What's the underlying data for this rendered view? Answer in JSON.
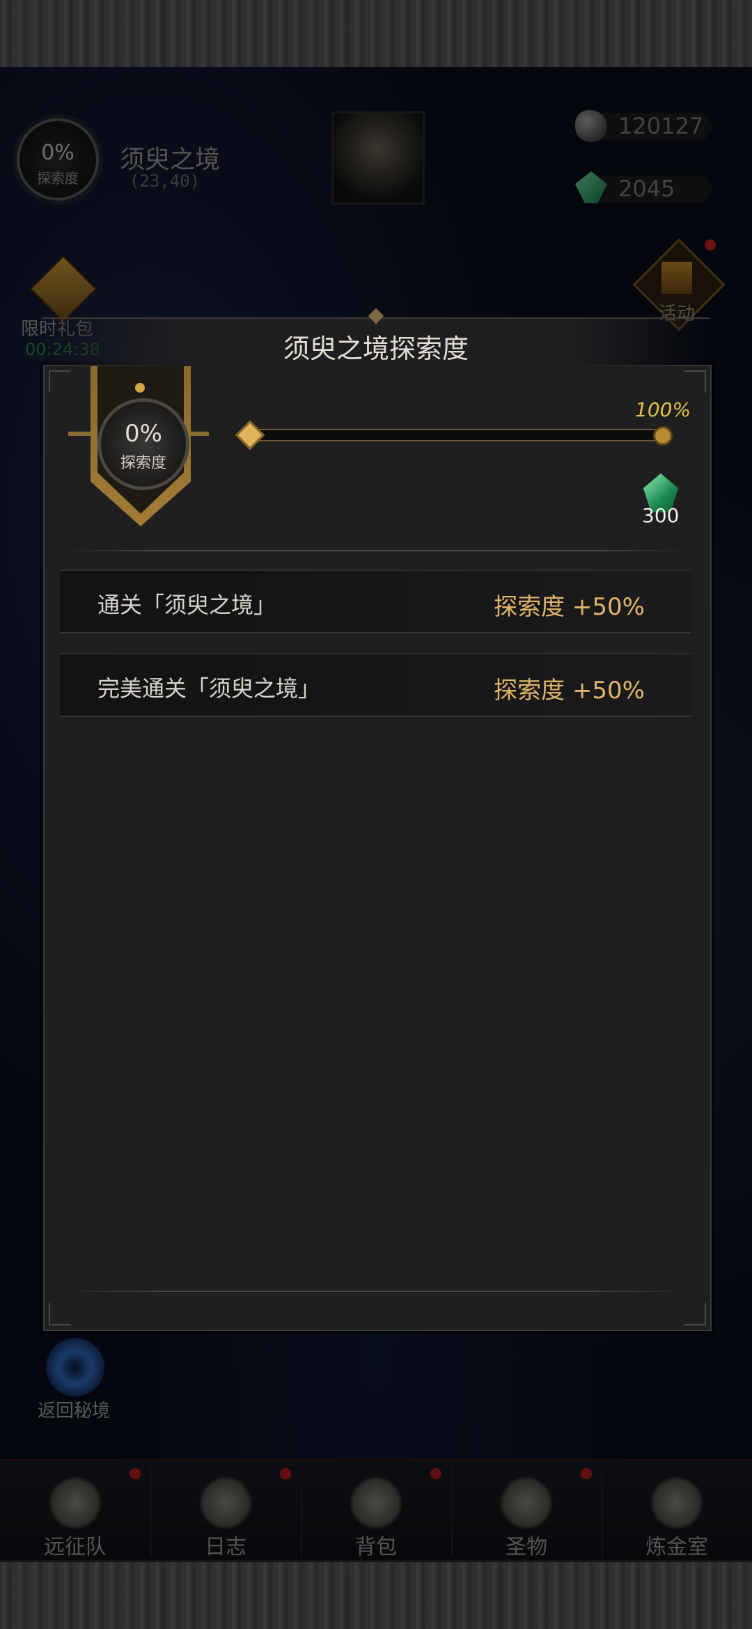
{
  "hud": {
    "zone_progress": "0%",
    "zone_progress_label": "探索度",
    "zone_name": "须臾之境",
    "zone_coords": "(23,40)",
    "resources": [
      {
        "icon": "ore-icon",
        "value": "120127"
      },
      {
        "icon": "green-gem-icon",
        "value": "2045"
      }
    ],
    "gift_pack": {
      "label": "限时礼包",
      "timer": "00:24:38"
    },
    "activity": {
      "label": "活动"
    }
  },
  "modal": {
    "title": "须臾之境探索度",
    "progress_value": "0%",
    "progress_label": "探索度",
    "progress_fraction": 0,
    "milestone_percent": "100%",
    "milestone_reward": {
      "icon": "green-gem-icon",
      "quantity": "300"
    },
    "tasks": [
      {
        "label": "通关「须臾之境」",
        "reward": "探索度 +50%"
      },
      {
        "label": "完美通关「须臾之境」",
        "reward": "探索度 +50%"
      }
    ]
  },
  "return_button": {
    "label": "返回秘境"
  },
  "nav": [
    {
      "label": "远征队",
      "icon": "helmet-icon",
      "badge": true
    },
    {
      "label": "日志",
      "icon": "scroll-icon",
      "badge": true
    },
    {
      "label": "背包",
      "icon": "backpack-icon",
      "badge": true
    },
    {
      "label": "圣物",
      "icon": "chalice-icon",
      "badge": true
    },
    {
      "label": "炼金室",
      "icon": "alchemy-icon",
      "badge": false
    }
  ],
  "colors": {
    "accent_gold": "#e0b56a",
    "milestone_yellow": "#e2c14b",
    "timer_green": "#2d8b3a",
    "badge_red": "#b41d1d"
  }
}
